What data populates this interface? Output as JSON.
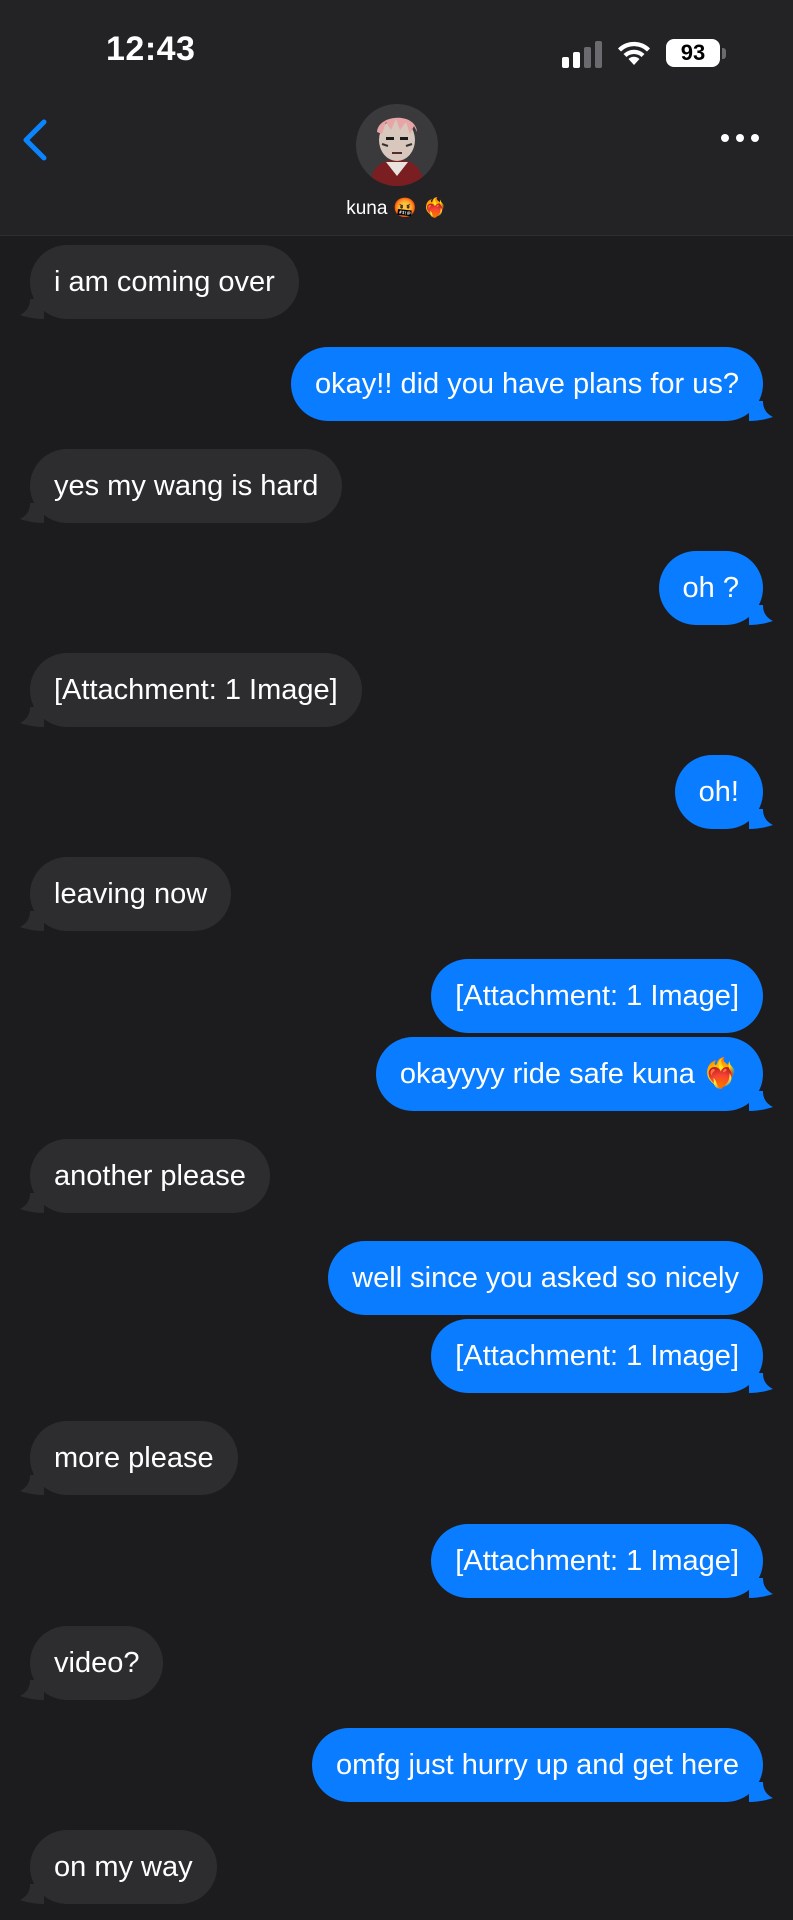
{
  "status_bar": {
    "time": "12:43",
    "battery": "93"
  },
  "header": {
    "contact_name": "kuna",
    "contact_emojis": "🤬 ❤️‍🔥"
  },
  "messages": [
    {
      "direction": "in",
      "text": "i am coming over"
    },
    {
      "direction": "out",
      "text": "okay!! did you have plans for us?"
    },
    {
      "direction": "in",
      "text": "yes my wang is hard"
    },
    {
      "direction": "out",
      "text": "oh ?"
    },
    {
      "direction": "in",
      "text": "[Attachment: 1 Image]"
    },
    {
      "direction": "out",
      "text": "oh!"
    },
    {
      "direction": "in",
      "text": "leaving now"
    },
    {
      "direction": "out",
      "text": "[Attachment: 1 Image]"
    },
    {
      "direction": "out",
      "text": "okayyyy ride safe kuna ❤️‍🔥"
    },
    {
      "direction": "in",
      "text": "another please"
    },
    {
      "direction": "out",
      "text": "well since you asked so nicely"
    },
    {
      "direction": "out",
      "text": "[Attachment: 1 Image]"
    },
    {
      "direction": "in",
      "text": "more please"
    },
    {
      "direction": "out",
      "text": "[Attachment: 1 Image]"
    },
    {
      "direction": "in",
      "text": "video?"
    },
    {
      "direction": "out",
      "text": "omfg just hurry up and get here"
    },
    {
      "direction": "in",
      "text": "on my way"
    }
  ],
  "colors": {
    "background": "#1c1c1e",
    "incoming_bubble": "#2d2d30",
    "outgoing_bubble": "#0a7cff",
    "accent": "#0a7cff"
  }
}
